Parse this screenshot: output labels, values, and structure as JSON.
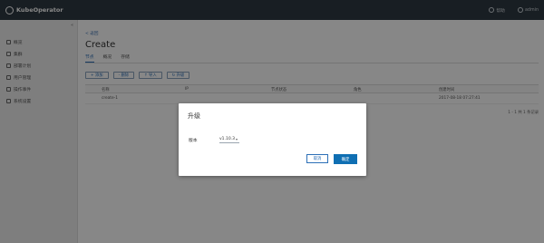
{
  "header": {
    "logo_text": "KubeOperator",
    "help_label": "帮助",
    "user_label": "admin"
  },
  "sidebar": {
    "collapse_glyph": "«",
    "items": [
      {
        "label": "概览",
        "icon": "home-icon"
      },
      {
        "label": "集群",
        "icon": "cluster-icon"
      },
      {
        "label": "部署计划",
        "icon": "plan-icon"
      },
      {
        "label": "用户管理",
        "icon": "user-icon"
      },
      {
        "label": "操作事件",
        "icon": "event-icon"
      },
      {
        "label": "系统设置",
        "icon": "settings-icon"
      }
    ]
  },
  "main": {
    "back_link": "< 返回",
    "title": "Create",
    "tabs": [
      "节点",
      "概况",
      "存储"
    ],
    "toolbar": [
      "+ 添加",
      "- 删除",
      "↑ 导入",
      "↻ 升级"
    ],
    "table": {
      "headers": [
        "名称",
        "IP",
        "节点状态",
        "角色",
        "创建时间"
      ],
      "row": [
        "create-1",
        "",
        "",
        "",
        "2017-08-18 07:27:41"
      ]
    },
    "pager": "1 - 1 共 1 条记录"
  },
  "modal": {
    "title": "升级",
    "version_label": "版本",
    "version_value": "v1.10.3",
    "cancel_label": "取消",
    "confirm_label": "确定"
  }
}
